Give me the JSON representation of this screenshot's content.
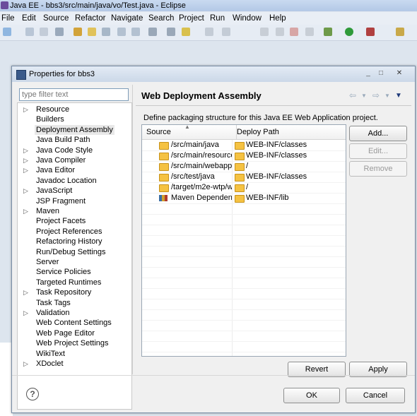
{
  "window": {
    "title": "Java EE - bbs3/src/main/java/vo/Test.java - Eclipse",
    "menu": [
      "File",
      "Edit",
      "Source",
      "Refactor",
      "Navigate",
      "Search",
      "Project",
      "Run",
      "Window",
      "Help"
    ]
  },
  "dialog": {
    "title": "Properties for bbs3",
    "filter_placeholder": "type filter text",
    "nav": [
      {
        "label": "Resource",
        "expandable": true
      },
      {
        "label": "Builders",
        "expandable": false
      },
      {
        "label": "Deployment Assembly",
        "expandable": false,
        "selected": true
      },
      {
        "label": "Java Build Path",
        "expandable": false
      },
      {
        "label": "Java Code Style",
        "expandable": true
      },
      {
        "label": "Java Compiler",
        "expandable": true
      },
      {
        "label": "Java Editor",
        "expandable": true
      },
      {
        "label": "Javadoc Location",
        "expandable": false
      },
      {
        "label": "JavaScript",
        "expandable": true
      },
      {
        "label": "JSP Fragment",
        "expandable": false
      },
      {
        "label": "Maven",
        "expandable": true
      },
      {
        "label": "Project Facets",
        "expandable": false
      },
      {
        "label": "Project References",
        "expandable": false
      },
      {
        "label": "Refactoring History",
        "expandable": false
      },
      {
        "label": "Run/Debug Settings",
        "expandable": false
      },
      {
        "label": "Server",
        "expandable": false
      },
      {
        "label": "Service Policies",
        "expandable": false
      },
      {
        "label": "Targeted Runtimes",
        "expandable": false
      },
      {
        "label": "Task Repository",
        "expandable": true
      },
      {
        "label": "Task Tags",
        "expandable": false
      },
      {
        "label": "Validation",
        "expandable": true
      },
      {
        "label": "Web Content Settings",
        "expandable": false
      },
      {
        "label": "Web Page Editor",
        "expandable": false
      },
      {
        "label": "Web Project Settings",
        "expandable": false
      },
      {
        "label": "WikiText",
        "expandable": false
      },
      {
        "label": "XDoclet",
        "expandable": true
      }
    ],
    "page_title": "Web Deployment Assembly",
    "description": "Define packaging structure for this Java EE Web Application project.",
    "table": {
      "headers": {
        "source": "Source",
        "deploy": "Deploy Path"
      },
      "rows": [
        {
          "source": "/src/main/java",
          "deploy": "WEB-INF/classes",
          "icon": "folder-icon"
        },
        {
          "source": "/src/main/resource",
          "deploy": "WEB-INF/classes",
          "icon": "folder-icon"
        },
        {
          "source": "/src/main/webapp",
          "deploy": "/",
          "icon": "folder-icon"
        },
        {
          "source": "/src/test/java",
          "deploy": "WEB-INF/classes",
          "icon": "folder-icon"
        },
        {
          "source": "/target/m2e-wtp/w",
          "deploy": "/",
          "icon": "folder-icon"
        },
        {
          "source": "Maven Dependenc",
          "deploy": "WEB-INF/lib",
          "icon": "maven-library-icon"
        }
      ]
    },
    "buttons": {
      "add": "Add...",
      "edit": "Edit...",
      "remove": "Remove",
      "revert": "Revert",
      "apply": "Apply",
      "ok": "OK",
      "cancel": "Cancel"
    },
    "help_glyph": "?"
  }
}
